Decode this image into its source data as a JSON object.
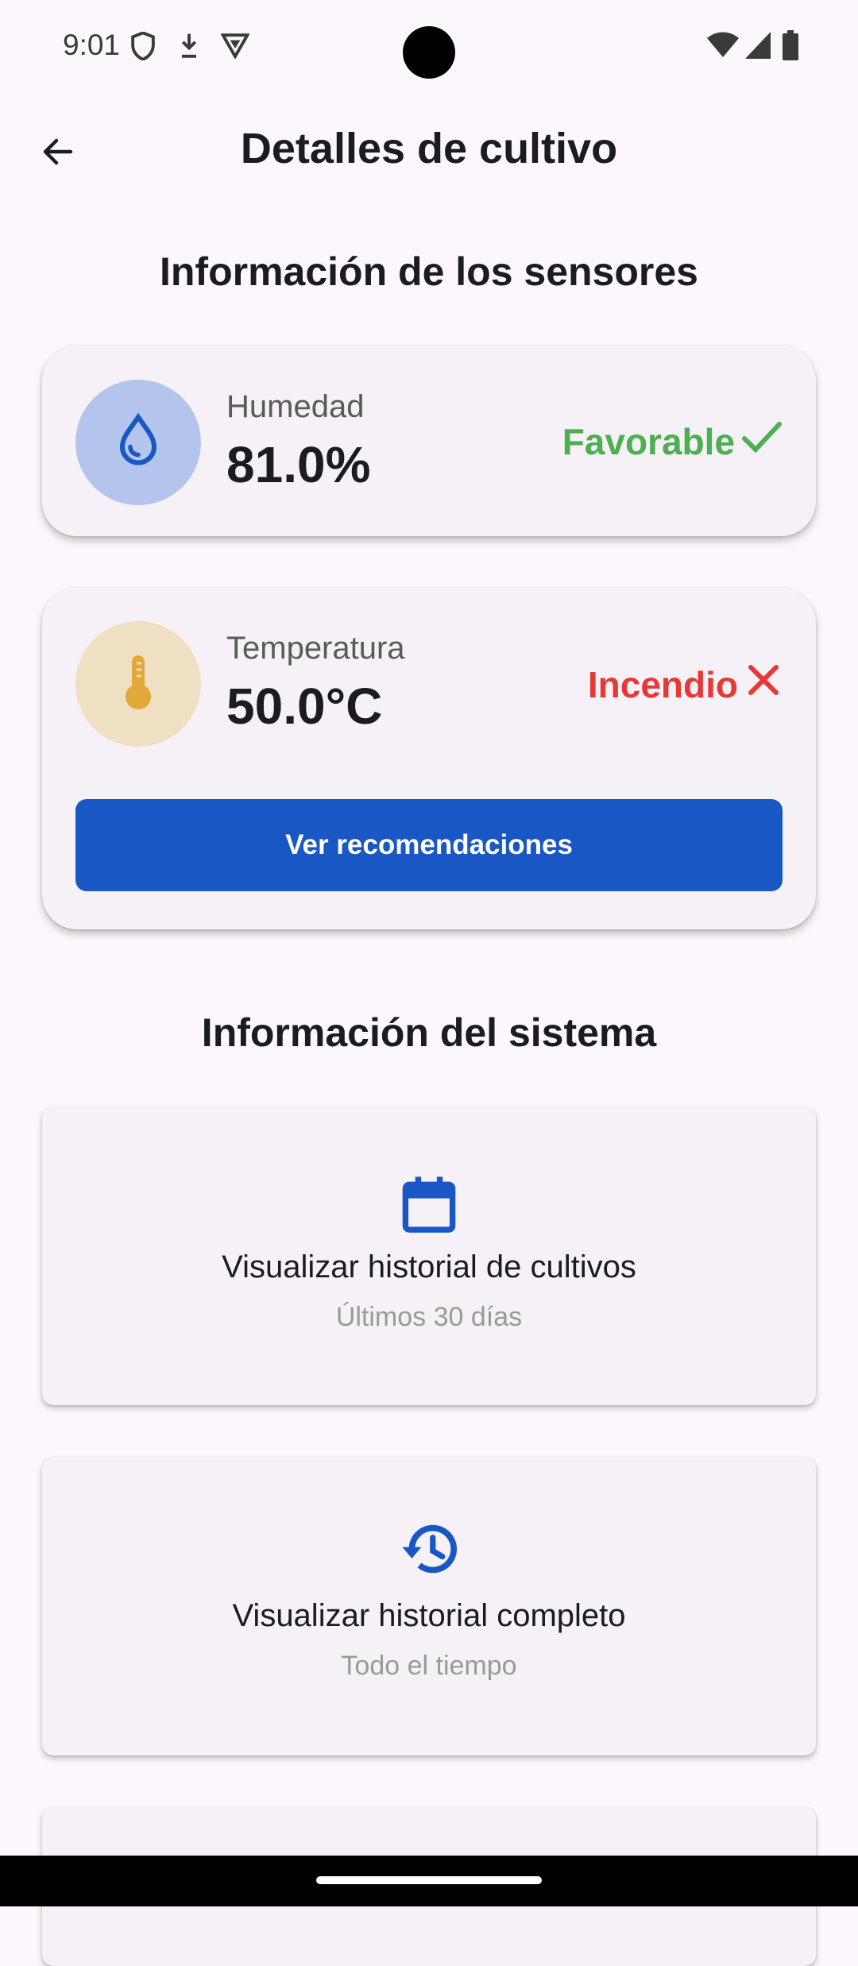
{
  "status_bar": {
    "time": "9:01",
    "left_icons": [
      "shield-icon",
      "download-icon",
      "vpn-icon"
    ],
    "right_icons": [
      "wifi-icon",
      "signal-icon",
      "battery-icon"
    ]
  },
  "app_bar": {
    "back_icon": "arrow-back-icon",
    "title": "Detalles de cultivo"
  },
  "sensors_section": {
    "title": "Información de los sensores",
    "humidity": {
      "icon": "water-drop-icon",
      "label": "Humedad",
      "value": "81.0%",
      "status": "Favorable",
      "status_icon": "check-icon",
      "status_color": "#4caf50",
      "circle_color": "#b3c5ec",
      "icon_color": "#1857c4"
    },
    "temperature": {
      "icon": "thermometer-icon",
      "label": "Temperatura",
      "value": "50.0°C",
      "status": "Incendio",
      "status_icon": "close-icon",
      "status_color": "#e53935",
      "circle_color": "#efdfc3",
      "icon_color": "#e3a83a"
    },
    "recommendations_button": "Ver recomendaciones"
  },
  "system_section": {
    "title": "Información del sistema",
    "cards": [
      {
        "icon": "calendar-icon",
        "title": "Visualizar historial de cultivos",
        "subtitle": "Últimos 30 días"
      },
      {
        "icon": "history-icon",
        "title": "Visualizar historial completo",
        "subtitle": "Todo el tiempo"
      }
    ]
  },
  "colors": {
    "background": "#fcf7fc",
    "card": "#f5f1f7",
    "primary": "#1857c4"
  }
}
